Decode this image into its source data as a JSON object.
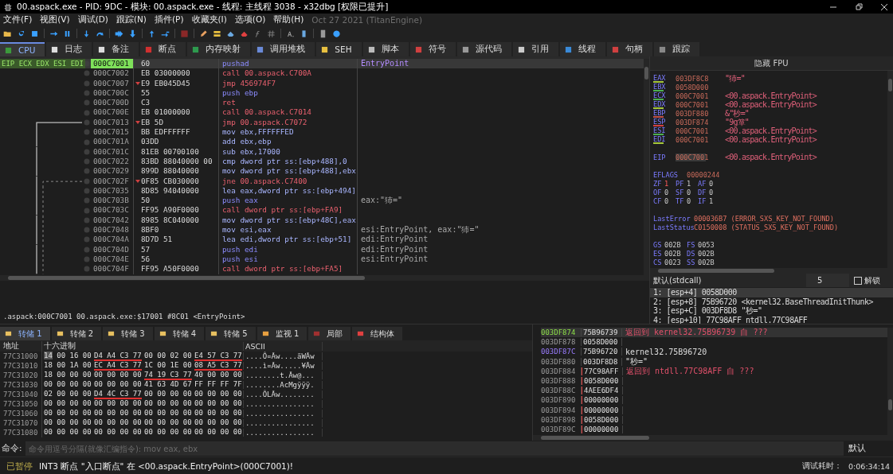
{
  "window": {
    "title": "00.aspack.exe - PID: 9DC - 模块: 00.aspack.exe - 线程: 主线程 3038 - x32dbg [权限已提升]"
  },
  "menu": {
    "items": [
      "文件(F)",
      "视图(V)",
      "调试(D)",
      "跟踪(N)",
      "插件(P)",
      "收藏夹(I)",
      "选项(O)",
      "帮助(H)"
    ],
    "build_info": "Oct 27 2021 (TitanEngine)"
  },
  "tabs": [
    {
      "label": "CPU",
      "selected": true
    },
    {
      "label": "日志",
      "selected": false
    },
    {
      "label": "备注",
      "selected": false
    },
    {
      "label": "断点",
      "selected": false
    },
    {
      "label": "内存映射",
      "selected": false
    },
    {
      "label": "调用堆栈",
      "selected": false
    },
    {
      "label": "SEH",
      "selected": false
    },
    {
      "label": "脚本",
      "selected": false
    },
    {
      "label": "符号",
      "selected": false
    },
    {
      "label": "源代码",
      "selected": false
    },
    {
      "label": "引用",
      "selected": false
    },
    {
      "label": "线程",
      "selected": false
    },
    {
      "label": "句柄",
      "selected": false
    },
    {
      "label": "跟踪",
      "selected": false
    }
  ],
  "disassembly": {
    "register_labels": "EIP ECX EDX ESI EDI",
    "rows": [
      {
        "address": "000C7001",
        "bytes": "60",
        "instruction": "pushad",
        "comment": "EntryPoint",
        "kind": "stack",
        "comment_is_label": true,
        "current": true,
        "branch_marker": false,
        "branch_start": false
      },
      {
        "address": "000C7002",
        "bytes": "EB 03000000",
        "instruction": "call 00.aspack.C700A",
        "kind": "call",
        "current": false,
        "branch_marker": false,
        "branch_start": false
      },
      {
        "address": "000C7007",
        "bytes": "E9 EB045D45",
        "instruction": "jmp 456974F7",
        "kind": "jump",
        "current": false,
        "branch_marker": true,
        "branch_start": false
      },
      {
        "address": "000C700C",
        "bytes": "55",
        "instruction": "push ebp",
        "kind": "stack",
        "current": false,
        "branch_marker": false,
        "branch_start": false
      },
      {
        "address": "000C700D",
        "bytes": "C3",
        "instruction": "ret",
        "kind": "ret",
        "current": false,
        "branch_marker": false,
        "branch_start": false
      },
      {
        "address": "000C700E",
        "bytes": "EB 01000000",
        "instruction": "call 00.aspack.C7014",
        "kind": "call",
        "current": false,
        "branch_marker": false,
        "branch_start": false
      },
      {
        "address": "000C7013",
        "bytes": "EB 5D",
        "instruction": "jmp 00.aspack.C7072",
        "kind": "jump",
        "current": false,
        "branch_marker": true,
        "branch_start": true,
        "branch_dashed_line": false
      },
      {
        "address": "000C7015",
        "bytes": "BB EDFFFFFF",
        "instruction": "mov ebx,FFFFFFED",
        "kind": "data",
        "current": false,
        "branch_marker": false,
        "branch_start": false
      },
      {
        "address": "000C701A",
        "bytes": "03DD",
        "instruction": "add ebx,ebp",
        "kind": "data",
        "current": false,
        "branch_marker": false,
        "branch_start": false
      },
      {
        "address": "000C701C",
        "bytes": "81EB 00700100",
        "instruction": "sub ebx,17000",
        "kind": "data",
        "current": false,
        "branch_marker": false,
        "branch_start": false
      },
      {
        "address": "000C7022",
        "bytes": "83BD 88040000 00",
        "instruction": "cmp dword ptr ss:[ebp+488],0",
        "kind": "data",
        "current": false,
        "branch_marker": false,
        "branch_start": false
      },
      {
        "address": "000C7029",
        "bytes": "899D 88040000",
        "instruction": "mov dword ptr ss:[ebp+488],ebx",
        "kind": "data",
        "current": false,
        "branch_marker": false,
        "branch_start": false
      },
      {
        "address": "000C702F",
        "bytes": "0F85 CB030000",
        "instruction": "jne 00.aspack.C7400",
        "kind": "jump",
        "current": false,
        "branch_marker": true,
        "branch_start": true,
        "branch_dashed_line": true
      },
      {
        "address": "000C7035",
        "bytes": "8D85 94040000",
        "instruction": "lea eax,dword ptr ss:[ebp+494]",
        "kind": "data",
        "current": false,
        "branch_marker": false,
        "branch_start": false
      },
      {
        "address": "000C703B",
        "bytes": "50",
        "instruction": "push eax",
        "comment": "eax:\"犻=\"",
        "kind": "stack",
        "comment_is_label": false,
        "current": false,
        "branch_marker": false,
        "branch_start": false
      },
      {
        "address": "000C703C",
        "bytes": "FF95 A90F0000",
        "instruction": "call dword ptr ss:[ebp+FA9]",
        "kind": "call",
        "current": false,
        "branch_marker": false,
        "branch_start": false
      },
      {
        "address": "000C7042",
        "bytes": "8985 8C040000",
        "instruction": "mov dword ptr ss:[ebp+48C],eax",
        "kind": "data",
        "current": false,
        "branch_marker": false,
        "branch_start": false
      },
      {
        "address": "000C7048",
        "bytes": "8BF0",
        "instruction": "mov esi,eax",
        "comment": "esi:EntryPoint, eax:\"犻=\"",
        "kind": "data",
        "comment_is_label": false,
        "current": false,
        "branch_marker": false,
        "branch_start": false
      },
      {
        "address": "000C704A",
        "bytes": "8D7D 51",
        "instruction": "lea edi,dword ptr ss:[ebp+51]",
        "comment": "edi:EntryPoint",
        "kind": "data",
        "comment_is_label": false,
        "current": false,
        "branch_marker": false,
        "branch_start": false
      },
      {
        "address": "000C704D",
        "bytes": "57",
        "instruction": "push edi",
        "comment": "edi:EntryPoint",
        "kind": "stack",
        "comment_is_label": false,
        "current": false,
        "branch_marker": false,
        "branch_start": false
      },
      {
        "address": "000C704E",
        "bytes": "56",
        "instruction": "push esi",
        "comment": "esi:EntryPoint",
        "kind": "stack",
        "comment_is_label": false,
        "current": false,
        "branch_marker": false,
        "branch_start": false
      },
      {
        "address": "000C704F",
        "bytes": "FF95 A50F0000",
        "instruction": "call dword ptr ss:[ebp+FA5]",
        "kind": "call",
        "current": false,
        "branch_marker": false,
        "branch_start": false
      }
    ],
    "info_line": ".aspack:000C7001 00.aspack.exe:$17001 #8C01 <EntryPoint>"
  },
  "registers": {
    "header": "隐藏 FPU",
    "general": [
      {
        "name": "EAX",
        "value": "003DF8C8",
        "info": "\"犻=\"",
        "color": "#a6c83c"
      },
      {
        "name": "EBX",
        "value": "0058D000",
        "color": "#4caf50"
      },
      {
        "name": "ECX",
        "value": "000C7001",
        "info": "<00.aspack.EntryPoint>",
        "color": "#4caf50"
      },
      {
        "name": "EDX",
        "value": "000C7001",
        "info": "<00.aspack.EntryPoint>",
        "color": "#a6c83c"
      },
      {
        "name": "EBP",
        "value": "003DF880",
        "info": "&\"秒=\"",
        "color": "#c0504a"
      },
      {
        "name": "ESP",
        "value": "003DF874",
        "info": "\"9g箪\"",
        "color": "#d04040"
      },
      {
        "name": "ESI",
        "value": "000C7001",
        "info": "<00.aspack.EntryPoint>",
        "color": "#4caf50"
      },
      {
        "name": "EDI",
        "value": "000C7001",
        "info": "<00.aspack.EntryPoint>",
        "color": "#a6c83c"
      }
    ],
    "eip": {
      "name": "EIP",
      "value": "000C7001",
      "info": "<00.aspack.EntryPoint>"
    },
    "eflags": {
      "name": "EFLAGS",
      "value": "00000244"
    },
    "flag_rows": [
      [
        {
          "name": "ZF",
          "value": "1",
          "changed": true
        },
        {
          "name": "PF",
          "value": "1",
          "changed": false
        },
        {
          "name": "AF",
          "value": "0",
          "changed": false
        }
      ],
      [
        {
          "name": "OF",
          "value": "0",
          "changed": false
        },
        {
          "name": "SF",
          "value": "0",
          "changed": false
        },
        {
          "name": "DF",
          "value": "0",
          "changed": false
        }
      ],
      [
        {
          "name": "CF",
          "value": "0",
          "changed": false
        },
        {
          "name": "TF",
          "value": "0",
          "changed": false
        },
        {
          "name": "IF",
          "value": "1",
          "changed": false
        }
      ]
    ],
    "last": [
      {
        "name": "LastError",
        "value": "000036B7 (ERROR_SXS_KEY_NOT_FOUND)"
      },
      {
        "name": "LastStatus",
        "value": "C0150008 (STATUS_SXS_KEY_NOT_FOUND)"
      }
    ],
    "segment_rows": [
      [
        {
          "name": "GS",
          "value": "002B"
        },
        {
          "name": "FS",
          "value": "0053"
        }
      ],
      [
        {
          "name": "ES",
          "value": "002B"
        },
        {
          "name": "DS",
          "value": "002B"
        }
      ],
      [
        {
          "name": "CS",
          "value": "0023"
        },
        {
          "name": "SS",
          "value": "002B"
        }
      ]
    ]
  },
  "call_convention": {
    "value": "默认(stdcall)",
    "count": "5",
    "unlock": {
      "label": "解锁",
      "checked": false
    }
  },
  "arguments": [
    {
      "text": "1: [esp+4] 0058D000",
      "selected": true
    },
    {
      "text": "2: [esp+8] 75B96720 <kernel32.BaseThreadInitThunk>",
      "selected": false
    },
    {
      "text": "3: [esp+C] 003DF8D8 \"秒=\"",
      "selected": false
    },
    {
      "text": "4: [esp+10] 77C98AFF ntdll.77C98AFF",
      "selected": false
    }
  ],
  "dump": {
    "tabs": [
      {
        "label": "转储 1",
        "selected": true
      },
      {
        "label": "转储 2",
        "selected": false
      },
      {
        "label": "转储 3",
        "selected": false
      },
      {
        "label": "转储 4",
        "selected": false
      },
      {
        "label": "转储 5",
        "selected": false
      },
      {
        "label": "监视 1",
        "selected": false
      },
      {
        "label": "局部",
        "selected": false
      },
      {
        "label": "结构体",
        "selected": false
      }
    ],
    "columns": [
      "地址",
      "十六进制",
      "ASCII"
    ],
    "rows": [
      {
        "address": "77C31000",
        "cursor": true,
        "groups": [
          {
            "bytes": "14 00 16 00",
            "pointer": false
          },
          {
            "bytes": "D4 A4 C3 77",
            "pointer": true
          },
          {
            "bytes": "00 00 02 00",
            "pointer": false
          },
          {
            "bytes": "E4 57 C3 77",
            "pointer": true
          }
        ],
        "ascii": "....Ô¤Ãw....äWÃw"
      },
      {
        "address": "77C31010",
        "cursor": false,
        "groups": [
          {
            "bytes": "18 00 1A 00",
            "pointer": false
          },
          {
            "bytes": "EC A4 C3 77",
            "pointer": true
          },
          {
            "bytes": "1C 00 1E 00",
            "pointer": false
          },
          {
            "bytes": "08 A5 C3 77",
            "pointer": true
          }
        ],
        "ascii": "....ì¤Ãw.....¥Ãw"
      },
      {
        "address": "77C31020",
        "cursor": false,
        "groups": [
          {
            "bytes": "18 00 00 00",
            "pointer": false
          },
          {
            "bytes": "00 00 00 00",
            "pointer": false
          },
          {
            "bytes": "74 19 C3 77",
            "pointer": true
          },
          {
            "bytes": "40 00 00 00",
            "pointer": false
          }
        ],
        "ascii": "........t.Ãw@..."
      },
      {
        "address": "77C31030",
        "cursor": false,
        "groups": [
          {
            "bytes": "00 00 00 00",
            "pointer": false
          },
          {
            "bytes": "00 00 00 00",
            "pointer": false
          },
          {
            "bytes": "41 63 4D 67",
            "pointer": false
          },
          {
            "bytes": "FF FF FF 7F",
            "pointer": false
          }
        ],
        "ascii": "........AcMgÿÿÿ."
      },
      {
        "address": "77C31040",
        "cursor": false,
        "groups": [
          {
            "bytes": "02 00 00 00",
            "pointer": false
          },
          {
            "bytes": "D4 4C C3 77",
            "pointer": true
          },
          {
            "bytes": "00 00 00 00",
            "pointer": false
          },
          {
            "bytes": "00 00 00 00",
            "pointer": false
          }
        ],
        "ascii": "....ÔLÃw........"
      },
      {
        "address": "77C31050",
        "cursor": false,
        "groups": [
          {
            "bytes": "00 00 00 00",
            "pointer": false
          },
          {
            "bytes": "00 00 00 00",
            "pointer": false
          },
          {
            "bytes": "00 00 00 00",
            "pointer": false
          },
          {
            "bytes": "00 00 00 00",
            "pointer": false
          }
        ],
        "ascii": "................"
      },
      {
        "address": "77C31060",
        "cursor": false,
        "groups": [
          {
            "bytes": "00 00 00 00",
            "pointer": false
          },
          {
            "bytes": "00 00 00 00",
            "pointer": false
          },
          {
            "bytes": "00 00 00 00",
            "pointer": false
          },
          {
            "bytes": "00 00 00 00",
            "pointer": false
          }
        ],
        "ascii": "................"
      },
      {
        "address": "77C31070",
        "cursor": false,
        "groups": [
          {
            "bytes": "00 00 00 00",
            "pointer": false
          },
          {
            "bytes": "00 00 00 00",
            "pointer": false
          },
          {
            "bytes": "00 00 00 00",
            "pointer": false
          },
          {
            "bytes": "00 00 00 00",
            "pointer": false
          }
        ],
        "ascii": "................"
      },
      {
        "address": "77C31080",
        "cursor": false,
        "groups": [
          {
            "bytes": "00 00 00 00",
            "pointer": false
          },
          {
            "bytes": "00 00 00 00",
            "pointer": false
          },
          {
            "bytes": "00 00 00 00",
            "pointer": false
          },
          {
            "bytes": "00 00 00 00",
            "pointer": false
          }
        ],
        "ascii": "................"
      }
    ]
  },
  "stack": {
    "rows": [
      {
        "address": "003DF874",
        "value": "75B96739",
        "comment": "返回到 kernel32.75B96739 自 ???",
        "esp": true,
        "ebp": false,
        "kind": "return",
        "in_frame": false
      },
      {
        "address": "003DF878",
        "value": "0058D000",
        "esp": false,
        "ebp": false,
        "kind": "plain",
        "in_frame": false
      },
      {
        "address": "003DF87C",
        "value": "75B96720",
        "comment": "kernel32.75B96720",
        "esp": false,
        "ebp": true,
        "kind": "plain",
        "in_frame": false
      },
      {
        "address": "003DF880",
        "value": "003DF8D8",
        "comment": "\"秒=\"",
        "esp": false,
        "ebp": false,
        "kind": "plain",
        "in_frame": false
      },
      {
        "address": "003DF884",
        "value": "77C98AFF",
        "comment": "返回到 ntdll.77C98AFF 自 ???",
        "esp": false,
        "ebp": false,
        "kind": "return",
        "in_frame": true
      },
      {
        "address": "003DF888",
        "value": "0058D000",
        "esp": false,
        "ebp": false,
        "kind": "plain",
        "in_frame": true
      },
      {
        "address": "003DF88C",
        "value": "4AEE6DF4",
        "esp": false,
        "ebp": false,
        "kind": "plain",
        "in_frame": true
      },
      {
        "address": "003DF890",
        "value": "00000000",
        "esp": false,
        "ebp": false,
        "kind": "plain",
        "in_frame": true
      },
      {
        "address": "003DF894",
        "value": "00000000",
        "esp": false,
        "ebp": false,
        "kind": "plain",
        "in_frame": true
      },
      {
        "address": "003DF898",
        "value": "0058D000",
        "esp": false,
        "ebp": false,
        "kind": "plain",
        "in_frame": true
      },
      {
        "address": "003DF89C",
        "value": "00000000",
        "esp": false,
        "ebp": false,
        "kind": "plain",
        "in_frame": true
      }
    ]
  },
  "command": {
    "label": "命令:",
    "placeholder": "命令用逗号分隔(就像汇编指令): mov eax, ebx",
    "mode": "默认"
  },
  "status": {
    "state": "已暂停",
    "message": "INT3 断点 \"入口断点\" 在 <00.aspack.EntryPoint>(000C7001)!",
    "timer_label": "调试耗时：",
    "timer": "0:06:34:14"
  }
}
